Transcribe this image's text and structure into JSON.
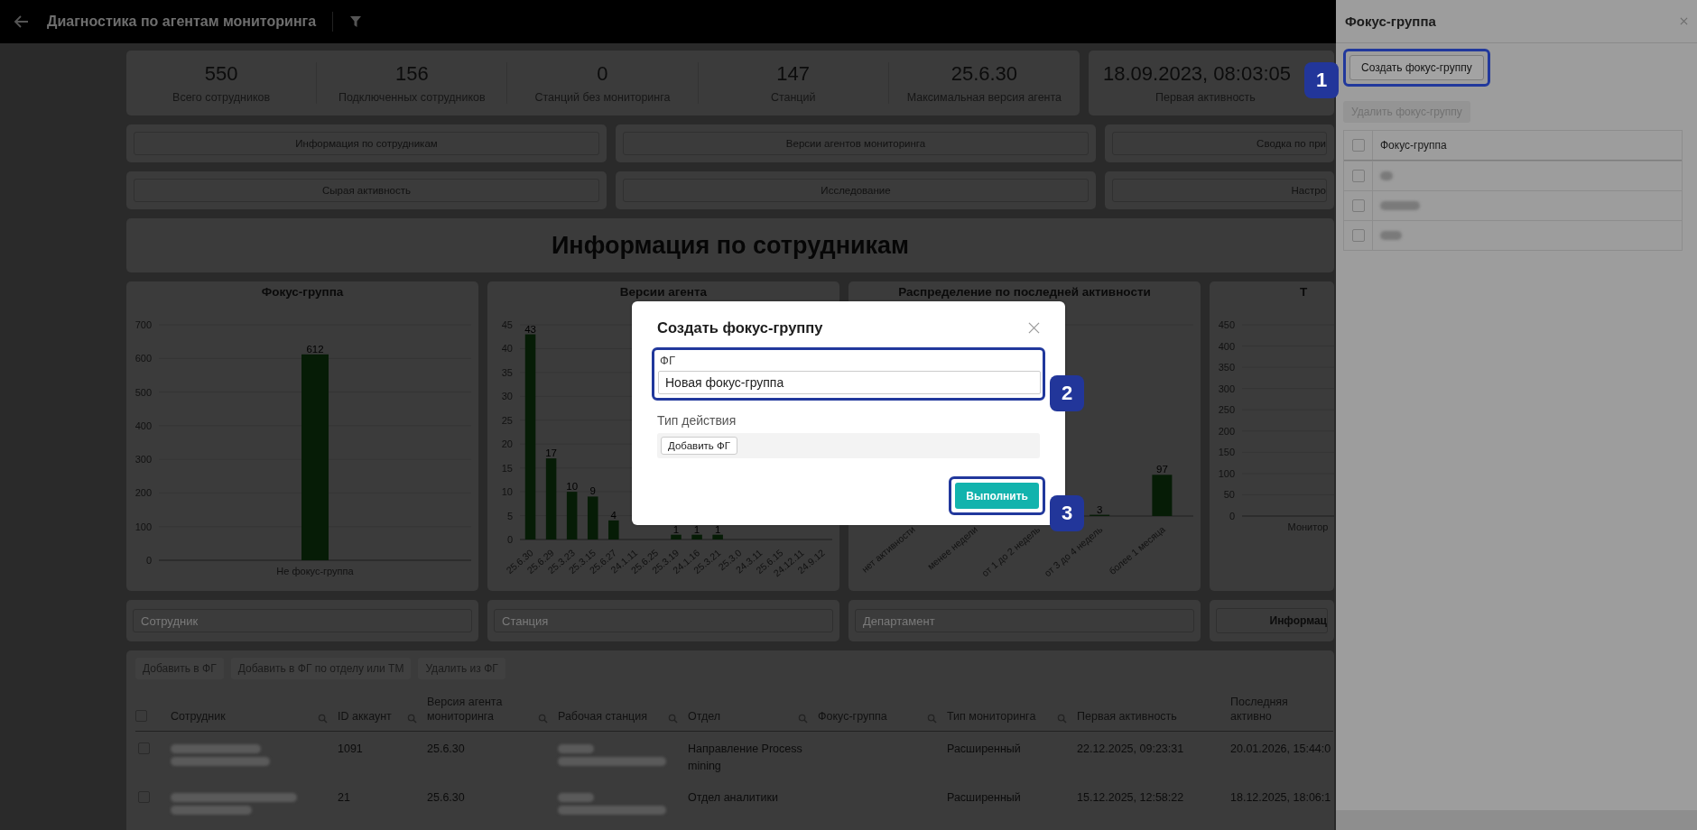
{
  "header": {
    "title": "Диагностика по агентам мониторинга"
  },
  "stats": [
    {
      "value": "550",
      "label": "Всего сотрудников"
    },
    {
      "value": "156",
      "label": "Подключенных сотрудников"
    },
    {
      "value": "0",
      "label": "Станций без мониторинга"
    },
    {
      "value": "147",
      "label": "Станций"
    },
    {
      "value": "25.6.30",
      "label": "Максимальная версия агента"
    }
  ],
  "first_activity": {
    "value": "18.09.2023, 08:03:05",
    "label": "Первая активность"
  },
  "nav_buttons": [
    "Информация по сотрудникам",
    "Версии агентов мониторинга",
    "Сводка по при",
    "Сырая активность",
    "Исследование",
    "Настро"
  ],
  "section_title": "Информация по сотрудникам",
  "charts": [
    {
      "chart_data": {
        "type": "bar",
        "title": "Фокус-группа",
        "categories": [
          "Не фокус-группа"
        ],
        "values": [
          612
        ],
        "ylim": [
          0,
          700
        ],
        "yticks": [
          0,
          100,
          200,
          300,
          400,
          500,
          600,
          700
        ],
        "grid": true,
        "data_labels": true
      }
    },
    {
      "chart_data": {
        "type": "bar",
        "title": "Версии агента",
        "categories": [
          "25.6.30",
          "25.6.29",
          "25.3.23",
          "25.3.15",
          "25.6.27",
          "24.1.11",
          "25.6.25",
          "25.3.19",
          "24.1.16",
          "25.3.21",
          "25.3.0",
          "24.3.11",
          "25.6.15",
          "24.12.11",
          "24.9.12"
        ],
        "values": [
          43,
          17,
          10,
          9,
          4,
          null,
          null,
          1,
          1,
          1,
          null,
          null,
          null,
          null,
          null
        ],
        "ylim": [
          0,
          45
        ],
        "yticks": [
          0,
          5,
          10,
          15,
          20,
          25,
          30,
          35,
          40,
          45
        ],
        "grid": true,
        "data_labels": true
      }
    },
    {
      "chart_data": {
        "type": "bar",
        "title": "Распределение по последней активности",
        "categories": [
          "нет активности",
          "менее недели",
          "от 1 до 2 недель",
          "от 3 до 4 недель",
          "более 1 месяца"
        ],
        "values": [
          null,
          null,
          null,
          3,
          97
        ],
        "ylim": [
          0,
          450
        ],
        "grid": true,
        "data_labels": true
      }
    },
    {
      "chart_data": {
        "type": "bar",
        "title": "Т",
        "categories": [
          "Монитор"
        ],
        "values": [
          null
        ],
        "ylim": [
          0,
          450
        ],
        "yticks": [
          0,
          50,
          100,
          150,
          200,
          250,
          300,
          350,
          400,
          450
        ],
        "grid": true
      }
    }
  ],
  "filters": [
    {
      "placeholder": "Сотрудник"
    },
    {
      "placeholder": "Станция"
    },
    {
      "placeholder": "Департамент"
    }
  ],
  "filter_button": "Информац",
  "table": {
    "actions": [
      "Добавить в ФГ",
      "Добавить в ФГ по отделу или ТМ",
      "Удалить из ФГ"
    ],
    "header_checked": false,
    "columns": [
      {
        "label": "Сотрудник",
        "searchable": true
      },
      {
        "label": "ID аккаунт",
        "searchable": true
      },
      {
        "label": "Версия агента мониторинга",
        "searchable": true
      },
      {
        "label": "Рабочая станция",
        "searchable": true
      },
      {
        "label": "Отдел",
        "searchable": true
      },
      {
        "label": "Фокус-группа",
        "searchable": true
      },
      {
        "label": "Тип мониторинга",
        "searchable": true
      },
      {
        "label": "Первая активность",
        "searchable": false
      },
      {
        "label": "Последняя активно",
        "searchable": false
      }
    ],
    "rows": [
      {
        "selected": false,
        "id": "1091",
        "version": "25.6.30",
        "department": "Направление Process mining",
        "monitoring_type": "Расширенный",
        "first_activity": "22.12.2025, 09:23:31",
        "last_activity": "20.01.2026, 15:44:0"
      },
      {
        "selected": false,
        "id": "21",
        "version": "25.6.30",
        "department": "Отдел аналитики",
        "monitoring_type": "Расширенный",
        "first_activity": "15.12.2025, 12:58:22",
        "last_activity": "18.12.2025, 18:06:1"
      }
    ]
  },
  "drawer": {
    "title": "Фокус-группа",
    "create_button": {
      "label": "Создать фокус-группу",
      "badge": "1"
    },
    "delete_button": {
      "label": "Удалить фокус-группу",
      "disabled": true
    },
    "table": {
      "column": "Фокус-группа",
      "header_checked": false,
      "rows": [
        {
          "checked": false
        },
        {
          "checked": false
        },
        {
          "checked": false
        }
      ]
    }
  },
  "modal": {
    "title": "Создать фокус-группу",
    "field": {
      "label": "ФГ",
      "value": "Новая фокус-группа",
      "badge": "2"
    },
    "action_type": {
      "label": "Тип действия",
      "options": [
        {
          "label": "Добавить ФГ",
          "selected": true
        }
      ]
    },
    "submit": {
      "label": "Выполнить",
      "badge": "3"
    }
  }
}
